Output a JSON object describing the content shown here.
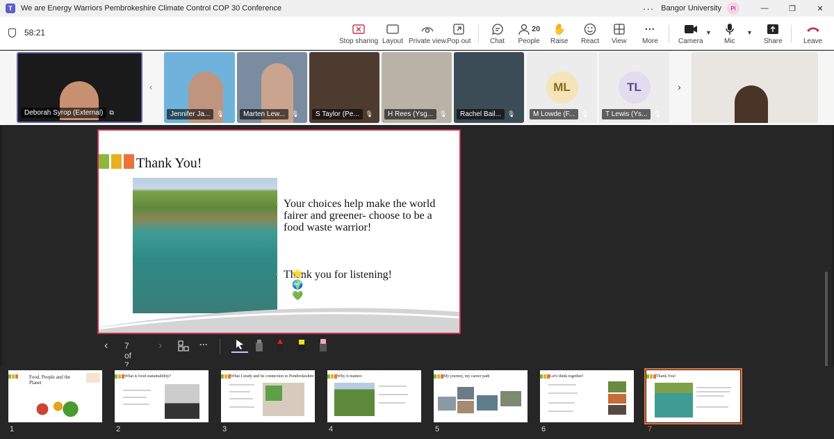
{
  "titlebar": {
    "title": "We are Energy Warriors Pembrokeshire Climate Control COP 30 Conference",
    "org": "Bangor University",
    "user_initials": "PI",
    "more_label": "···"
  },
  "toolbar": {
    "timer": "58:21",
    "buttons": {
      "stop_sharing": "Stop sharing",
      "layout": "Layout",
      "private_view": "Private view",
      "pop_out": "Pop out",
      "chat": "Chat",
      "people": "People",
      "people_count": "20",
      "raise": "Raise",
      "react": "React",
      "view": "View",
      "more": "More",
      "camera": "Camera",
      "mic": "Mic",
      "share": "Share",
      "leave": "Leave"
    }
  },
  "participants": [
    {
      "name": "Deborah Syrop (External)"
    },
    {
      "name": "Jennifer Ja..."
    },
    {
      "name": "Marten Lew..."
    },
    {
      "name": "S Taylor (Pe..."
    },
    {
      "name": "H Rees (Ysg..."
    },
    {
      "name": "Rachel Bail..."
    },
    {
      "name": "M Lowde (F...",
      "initials": "ML"
    },
    {
      "name": "T Lewis (Ys...",
      "initials": "TL"
    }
  ],
  "slide": {
    "title": "Thank You!",
    "bullet1": "Your choices help make the world fairer and greener- choose to be a food waste warrior!",
    "bullet2": "Thank you for listening!",
    "emoji": "🌟🌍💚"
  },
  "presenter": {
    "page_indicator": "7 of 7"
  },
  "thumbnails": [
    {
      "num": "1",
      "title": "Food, People and the Planet"
    },
    {
      "num": "2",
      "title": "What is food sustainability?"
    },
    {
      "num": "3",
      "title": "What I study and its connection to Pembrokeshire"
    },
    {
      "num": "4",
      "title": "Why it matters"
    },
    {
      "num": "5",
      "title": "My journey, my career path"
    },
    {
      "num": "6",
      "title": "Let's think together!"
    },
    {
      "num": "7",
      "title": "Thank You!"
    }
  ],
  "colors": {
    "accent_red": "#c4314b",
    "square_green": "#8bb839",
    "square_yellow": "#e6b222",
    "square_orange": "#e8743b",
    "selected_thumb": "#e8743b"
  }
}
